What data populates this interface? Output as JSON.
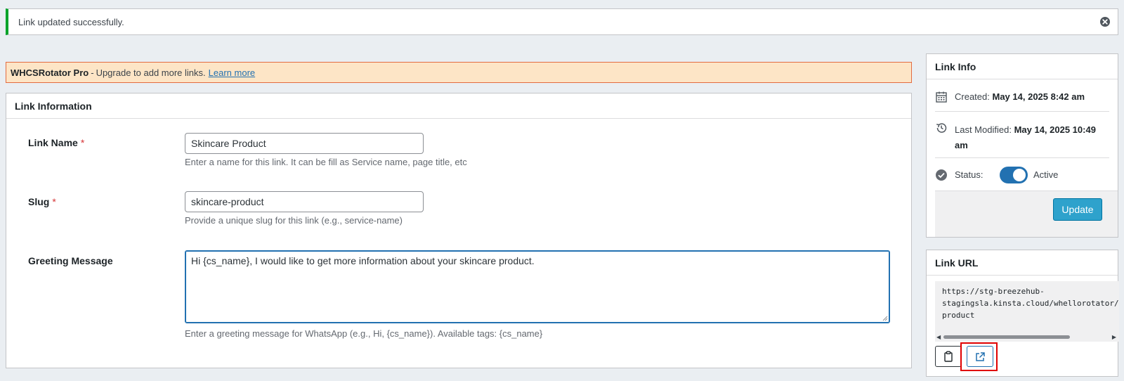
{
  "notice": {
    "message": "Link updated successfully.",
    "close_icon": "circle-x-icon"
  },
  "pro_banner": {
    "brand": "WHCSRotator Pro",
    "separator": "-",
    "text": "Upgrade to add more links.",
    "link_label": "Learn more"
  },
  "link_information": {
    "title": "Link Information",
    "fields": {
      "link_name": {
        "label": "Link Name",
        "required_mark": "*",
        "value": "Skincare Product",
        "description": "Enter a name for this link. It can be fill as Service name, page title, etc"
      },
      "slug": {
        "label": "Slug",
        "required_mark": "*",
        "value": "skincare-product",
        "description": "Provide a unique slug for this link (e.g., service-name)"
      },
      "greeting": {
        "label": "Greeting Message",
        "value": "Hi {cs_name}, I would like to get more information about your skincare product.",
        "description": "Enter a greeting message for WhatsApp (e.g., Hi, {cs_name}). Available tags: {cs_name}"
      }
    }
  },
  "link_info": {
    "title": "Link Info",
    "created_label": "Created:",
    "created_value": "May 14, 2025 8:42 am",
    "modified_label": "Last Modified:",
    "modified_value": "May 14, 2025 10:49 am",
    "status_label": "Status:",
    "status_value": "Active",
    "status_on": true,
    "update_label": "Update"
  },
  "link_url": {
    "title": "Link URL",
    "url_line1": "https://stg-breezehub-",
    "url_line2": "stagingsla.kinsta.cloud/whellorotator/",
    "url_line3": "product",
    "copy_icon": "clipboard-icon",
    "open_icon": "external-link-icon"
  },
  "colors": {
    "success_border": "#00a32a",
    "banner_bg": "#fde5c6",
    "banner_border": "#e36b40",
    "accent": "#2271b1",
    "update_button": "#2ea2cc",
    "highlight": "#e00000"
  }
}
